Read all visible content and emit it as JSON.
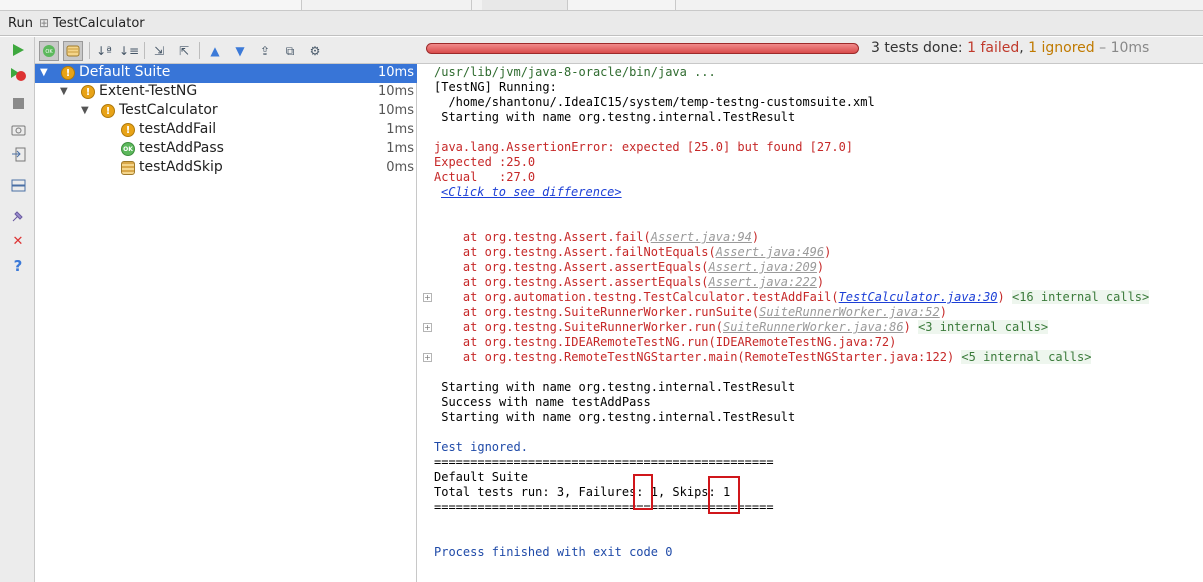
{
  "window": {
    "title_prefix": "Run",
    "title": "TestCalculator"
  },
  "toolbar": {
    "status_prefix": "3 tests done: ",
    "failed": "1 failed",
    "comma": ", ",
    "ignored": "1 ignored",
    "duration": " – 10ms",
    "progress_fraction": 1.0
  },
  "tree": [
    {
      "label": "Default Suite",
      "time": "10ms",
      "icon": "warning-icon",
      "selected": true
    },
    {
      "label": "Extent-TestNG",
      "time": "10ms",
      "icon": "warning-icon"
    },
    {
      "label": "TestCalculator",
      "time": "10ms",
      "icon": "warning-icon"
    },
    {
      "label": "testAddFail",
      "time": "1ms",
      "icon": "warning-icon"
    },
    {
      "label": "testAddPass",
      "time": "1ms",
      "icon": "ok-icon"
    },
    {
      "label": "testAddSkip",
      "time": "0ms",
      "icon": "skip-icon"
    }
  ],
  "console": {
    "cmd": "/usr/lib/jvm/java-8-oracle/bin/java ...",
    "running": "[TestNG] Running:",
    "suite_path": "  /home/shantonu/.IdeaIC15/system/temp-testng-customsuite.xml",
    "starting1": " Starting with name org.testng.internal.TestResult",
    "assertion": "java.lang.AssertionError: expected [25.0] but found [27.0]",
    "expected": "Expected :25.0",
    "actual": "Actual   :27.0",
    "diff_link": "<Click to see difference>",
    "trace": [
      {
        "pre": "    at org.testng.Assert.fail(",
        "link": "Assert.java:94",
        "post": ")",
        "internal": ""
      },
      {
        "pre": "    at org.testng.Assert.failNotEquals(",
        "link": "Assert.java:496",
        "post": ")",
        "internal": ""
      },
      {
        "pre": "    at org.testng.Assert.assertEquals(",
        "link": "Assert.java:209",
        "post": ")",
        "internal": ""
      },
      {
        "pre": "    at org.testng.Assert.assertEquals(",
        "link": "Assert.java:222",
        "post": ")",
        "internal": ""
      },
      {
        "pre": "    at org.automation.testng.TestCalculator.testAddFail(",
        "link": "TestCalculator.java:30",
        "post": ") ",
        "internal": "<16 internal calls>"
      },
      {
        "pre": "    at org.testng.SuiteRunnerWorker.runSuite(",
        "link": "SuiteRunnerWorker.java:52",
        "post": ")",
        "internal": ""
      },
      {
        "pre": "    at org.testng.SuiteRunnerWorker.run(",
        "link": "SuiteRunnerWorker.java:86",
        "post": ") ",
        "internal": "<3 internal calls>"
      },
      {
        "pre": "    at org.testng.IDEARemoteTestNG.run(IDEARemoteTestNG.java:72)",
        "link": "",
        "post": "",
        "internal": ""
      },
      {
        "pre": "    at org.testng.RemoteTestNGStarter.main(RemoteTestNGStarter.java:122) ",
        "link": "",
        "post": "",
        "internal": "<5 internal calls>"
      }
    ],
    "starting2": " Starting with name org.testng.internal.TestResult",
    "success": " Success with name testAddPass",
    "starting3": " Starting with name org.testng.internal.TestResult",
    "ignored": "Test ignored.",
    "rule": "===============================================",
    "suite_name": "Default Suite",
    "totals": "Total tests run: 3, Failures: 1, Skips: 1",
    "rule2": "===============================================",
    "exit": "Process finished with exit code 0"
  }
}
